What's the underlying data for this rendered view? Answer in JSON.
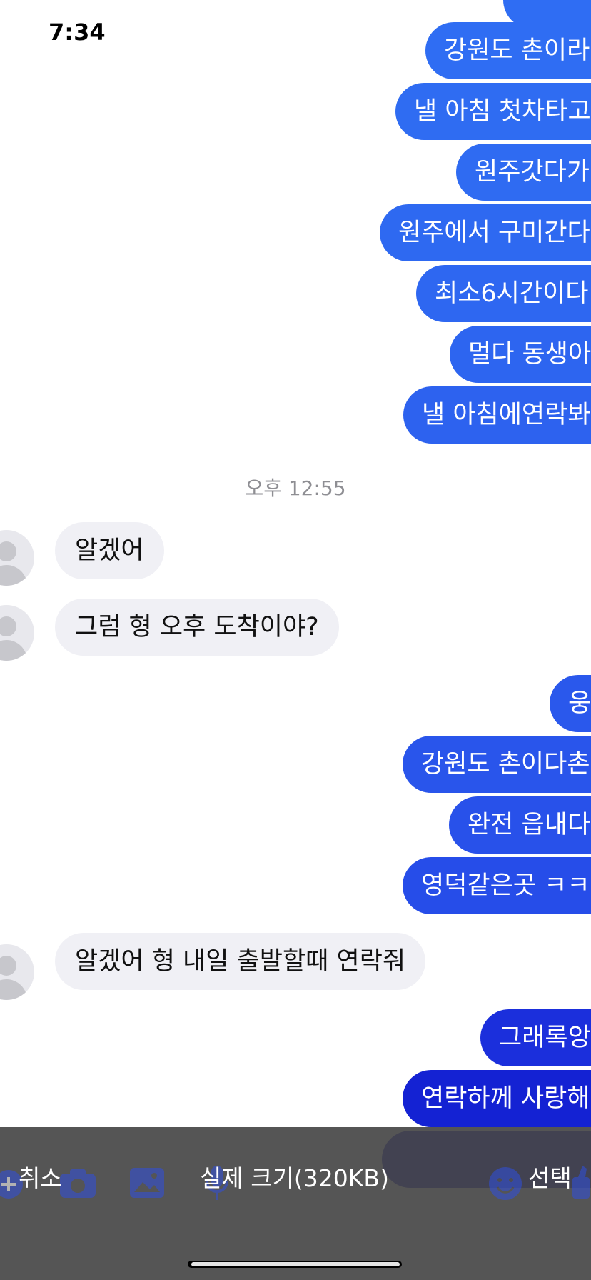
{
  "status_bar": {
    "time": "7:34"
  },
  "colors": {
    "out_bubble_top": "#2f6df3",
    "out_bubble_bottom": "#1313c8",
    "in_bubble": "#f0f0f5",
    "overlay": "#464646"
  },
  "messages_top": [
    "강원도 촌이라",
    "낼 아침 첫차타고",
    "원주갓다가",
    "원주에서 구미간다",
    "최소6시간이다",
    "멀다 동생아",
    "낼 아침에연락봐"
  ],
  "timestamp": "오후 12:55",
  "incoming": [
    "알겠어",
    "그럼 형 오후 도착이야?"
  ],
  "messages_mid": [
    "웅",
    "강원도 촌이다촌",
    "완전 읍내다",
    "영덕같은곳 ㅋㅋ"
  ],
  "incoming_2": "알겠어 형 내일 출발할때 연락줘",
  "messages_bottom": [
    "그래록앙",
    "연락하께 사랑해"
  ],
  "image_overlay": {
    "cancel_label": "취소",
    "title": "실제 크기(320KB)",
    "select_label": "선택"
  },
  "composer_icons": [
    "plus-icon",
    "camera-icon",
    "gallery-icon",
    "mic-icon",
    "emoji-icon",
    "like-icon"
  ]
}
